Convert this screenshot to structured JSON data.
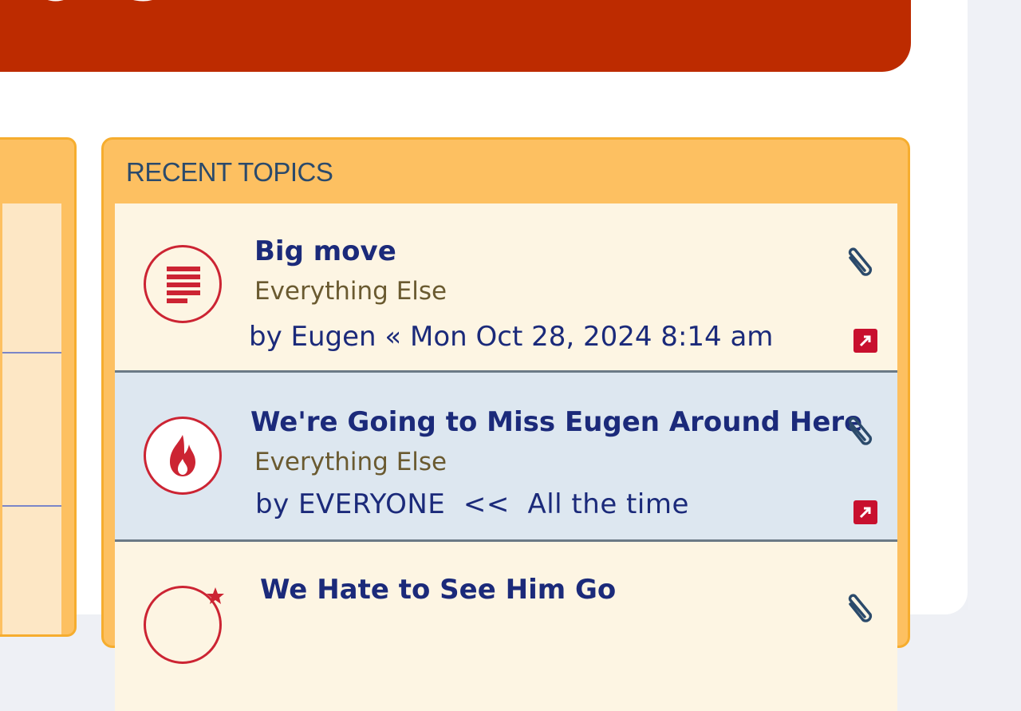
{
  "header": {
    "title": "ctors"
  },
  "recent_topics": {
    "heading": "RECENT TOPICS",
    "topics": [
      {
        "title": "Big move",
        "forum": "Everything Else",
        "meta": "by Eugen « Mon Oct 28, 2024 8:14 am",
        "icon": "topic-read-icon"
      },
      {
        "title": "We're Going to Miss Eugen Around Here",
        "forum": "Everything Else",
        "meta": "by EVERYONE  <<  All the time",
        "icon": "hot-topic-flame-icon"
      },
      {
        "title": "We Hate to See Him Go",
        "icon": "topic-starred-icon"
      }
    ]
  },
  "colors": {
    "banner": "#bd2b00",
    "panel": "#fdc061",
    "row": "#fdf5e3",
    "row_alt": "#dde7f0",
    "link": "#1b2a7a"
  }
}
